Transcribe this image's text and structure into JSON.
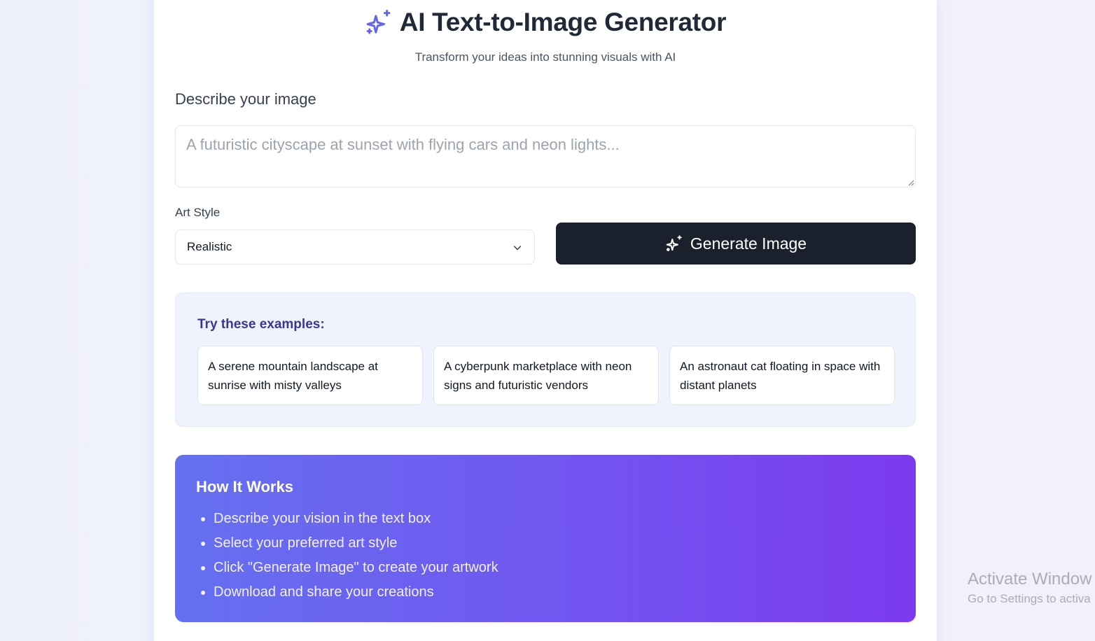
{
  "header": {
    "title": "AI Text-to-Image Generator",
    "subtitle": "Transform your ideas into stunning visuals with AI",
    "icon": "sparkles-icon",
    "accent_color": "#6366f1"
  },
  "prompt": {
    "label": "Describe your image",
    "value": "",
    "placeholder": "A futuristic cityscape at sunset with flying cars and neon lights..."
  },
  "art_style": {
    "label": "Art Style",
    "selected": "Realistic"
  },
  "generate_button": {
    "label": "Generate Image",
    "bg_color": "#1a202c"
  },
  "examples": {
    "title": "Try these examples:",
    "items": [
      {
        "text": "A serene mountain landscape at sunrise with misty valleys"
      },
      {
        "text": "A cyberpunk marketplace with neon signs and futuristic vendors"
      },
      {
        "text": "An astronaut cat floating in space with distant planets"
      }
    ]
  },
  "how_it_works": {
    "title": "How It Works",
    "steps": [
      "Describe your vision in the text box",
      "Select your preferred art style",
      "Click \"Generate Image\" to create your artwork",
      "Download and share your creations"
    ]
  },
  "watermark": {
    "line1": "Activate Window",
    "line2": "Go to Settings to activa"
  }
}
